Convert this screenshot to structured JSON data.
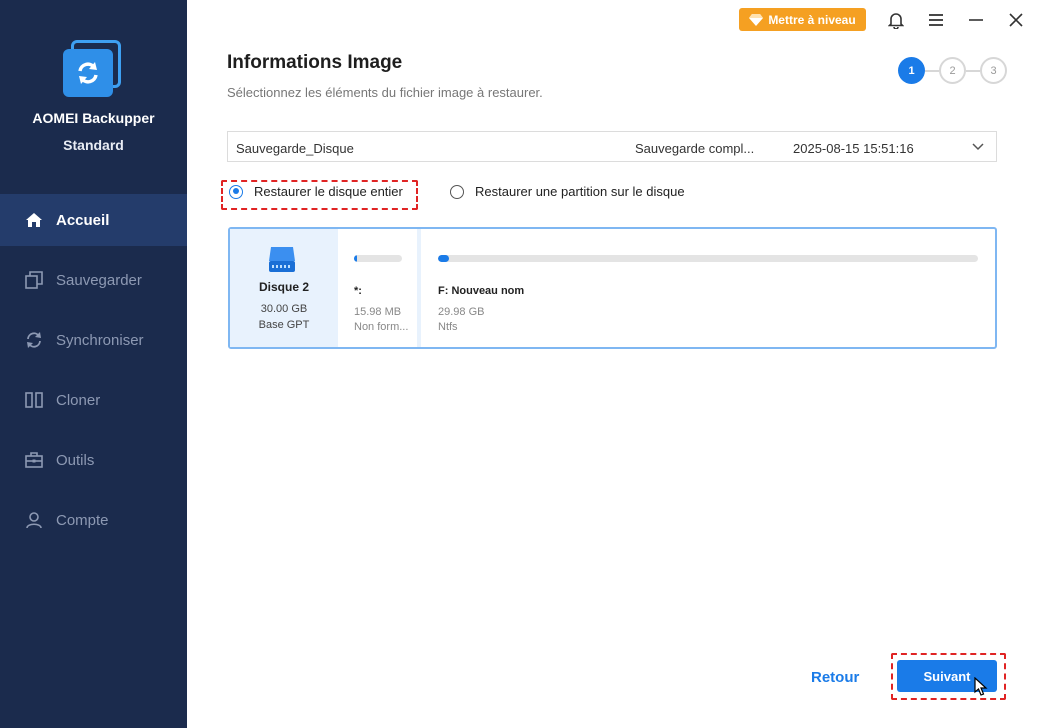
{
  "app": {
    "name": "AOMEI Backupper",
    "edition": "Standard"
  },
  "sidebar": {
    "items": [
      {
        "label": "Accueil",
        "icon": "home-icon",
        "active": true
      },
      {
        "label": "Sauvegarder",
        "icon": "backup-icon",
        "active": false
      },
      {
        "label": "Synchroniser",
        "icon": "sync-icon",
        "active": false
      },
      {
        "label": "Cloner",
        "icon": "clone-icon",
        "active": false
      },
      {
        "label": "Outils",
        "icon": "tools-icon",
        "active": false
      },
      {
        "label": "Compte",
        "icon": "account-icon",
        "active": false
      }
    ]
  },
  "topbar": {
    "upgrade_label": "Mettre à niveau",
    "icons": [
      "bell-icon",
      "menu-icon",
      "minimize-icon",
      "close-icon"
    ]
  },
  "main": {
    "title": "Informations Image",
    "subtitle": "Sélectionnez les éléments du fichier image à restaurer.",
    "steps": [
      "1",
      "2",
      "3"
    ],
    "current_step": 1,
    "image_select": {
      "name": "Sauvegarde_Disque",
      "type": "Sauvegarde compl...",
      "date": "2025-08-15 15:51:16"
    },
    "options": {
      "whole_disk": "Restaurer le disque entier",
      "partition": "Restaurer une partition sur le disque",
      "selected": "whole_disk"
    },
    "disk": {
      "name": "Disque 2",
      "size": "30.00 GB",
      "style": "Base GPT",
      "partitions": [
        {
          "label": "*:",
          "size": "15.98 MB",
          "fs": "Non form...",
          "used_fraction": 0.06
        },
        {
          "label": "F: Nouveau nom",
          "size": "29.98 GB",
          "fs": "Ntfs",
          "used_fraction": 0.02
        }
      ]
    }
  },
  "footer": {
    "back_label": "Retour",
    "next_label": "Suivant"
  },
  "colors": {
    "sidebar_bg": "#1b2b4d",
    "sidebar_active": "#243c6b",
    "accent": "#1a7be8",
    "upgrade": "#f5a022",
    "highlight": "#e02424"
  }
}
